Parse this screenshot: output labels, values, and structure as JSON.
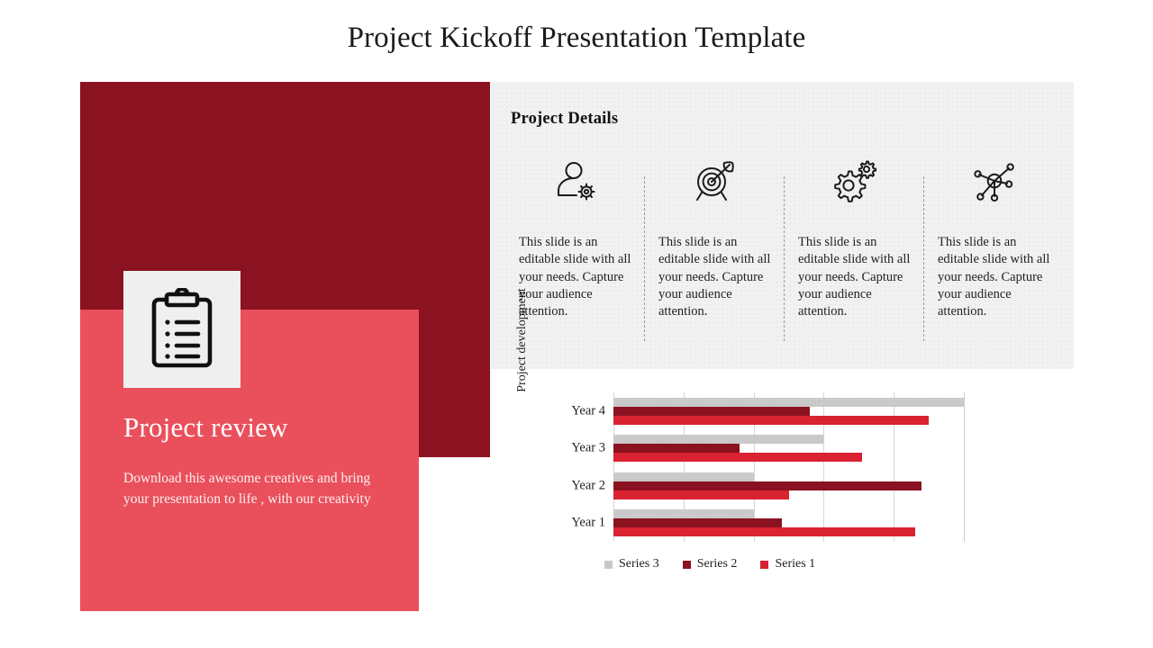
{
  "slide": {
    "title": "Project Kickoff Presentation Template"
  },
  "left_panel": {
    "icon": "clipboard-checklist-icon",
    "heading": "Project review",
    "subtitle": "Download this awesome creatives and bring your presentation to life , with our creativity",
    "dark_color": "#8B1220",
    "accent_color": "#E9505C",
    "card_color": "#F0F0F0"
  },
  "details_panel": {
    "title": "Project Details",
    "background": "#F1F1F1",
    "columns": [
      {
        "icon": "user-settings-icon",
        "text": "This slide is an editable slide with all your needs. Capture your audience attention."
      },
      {
        "icon": "target-arrow-icon",
        "text": "This slide is an editable slide with all your needs. Capture your audience attention."
      },
      {
        "icon": "gears-icon",
        "text": "This slide is an editable slide with all your needs. Capture your audience attention."
      },
      {
        "icon": "network-nodes-icon",
        "text": "This slide is an editable slide with all your needs. Capture your audience attention."
      }
    ]
  },
  "chart_data": {
    "type": "bar",
    "orientation": "horizontal",
    "title": "",
    "xlabel": "",
    "ylabel": "Project development",
    "categories": [
      "Year 4",
      "Year 3",
      "Year 2",
      "Year 1"
    ],
    "series": [
      {
        "name": "Series 3",
        "color": "#C8C8C8",
        "values": [
          100,
          60,
          40,
          40
        ]
      },
      {
        "name": "Series 2",
        "color": "#8B1220",
        "values": [
          56,
          36,
          88,
          48
        ]
      },
      {
        "name": "Series 1",
        "color": "#D92232",
        "values": [
          90,
          71,
          50,
          86
        ]
      }
    ],
    "xlim": [
      0,
      100
    ],
    "gridlines": [
      0,
      20,
      40,
      60,
      80,
      100
    ],
    "grid": true,
    "legend_position": "bottom",
    "legend_order": [
      "Series 3",
      "Series 2",
      "Series 1"
    ]
  }
}
